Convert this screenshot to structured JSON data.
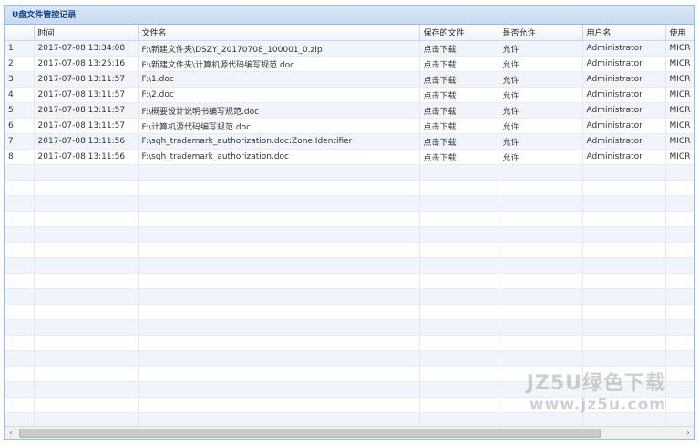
{
  "panel": {
    "title": "U盘文件管控记录"
  },
  "columns": [
    "",
    "时间",
    "文件名",
    "保存的文件",
    "是否允许",
    "用户名",
    "使用"
  ],
  "rows": [
    {
      "no": "1",
      "time": "2017-07-08 13:34:08",
      "file": "F:\\新建文件夹\\DSZY_20170708_100001_0.zip",
      "saved": "点击下载",
      "allowed": "允许",
      "user": "Administrator",
      "use": "MICR"
    },
    {
      "no": "2",
      "time": "2017-07-08 13:25:16",
      "file": "F:\\新建文件夹\\计算机源代码编写规范.doc",
      "saved": "点击下载",
      "allowed": "允许",
      "user": "Administrator",
      "use": "MICR"
    },
    {
      "no": "3",
      "time": "2017-07-08 13:11:57",
      "file": "F:\\1.doc",
      "saved": "点击下载",
      "allowed": "允许",
      "user": "Administrator",
      "use": "MICR"
    },
    {
      "no": "4",
      "time": "2017-07-08 13:11:57",
      "file": "F:\\2.doc",
      "saved": "点击下载",
      "allowed": "允许",
      "user": "Administrator",
      "use": "MICR"
    },
    {
      "no": "5",
      "time": "2017-07-08 13:11:57",
      "file": "F:\\概要设计说明书编写规范.doc",
      "saved": "点击下载",
      "allowed": "允许",
      "user": "Administrator",
      "use": "MICR"
    },
    {
      "no": "6",
      "time": "2017-07-08 13:11:57",
      "file": "F:\\计算机源代码编写规范.doc",
      "saved": "点击下载",
      "allowed": "允许",
      "user": "Administrator",
      "use": "MICR"
    },
    {
      "no": "7",
      "time": "2017-07-08 13:11:56",
      "file": "F:\\sqh_trademark_authorization.doc:Zone.Identifier",
      "saved": "点击下载",
      "allowed": "允许",
      "user": "Administrator",
      "use": "MICR"
    },
    {
      "no": "8",
      "time": "2017-07-08 13:11:56",
      "file": "F:\\sqh_trademark_authorization.doc",
      "saved": "点击下载",
      "allowed": "允许",
      "user": "Administrator",
      "use": "MICR"
    }
  ],
  "scrollbar": {
    "left_arrow": "‹",
    "right_arrow": "›"
  },
  "watermark": {
    "brand": "JZ5U绿色下载",
    "url": "www.jz5u.com"
  }
}
